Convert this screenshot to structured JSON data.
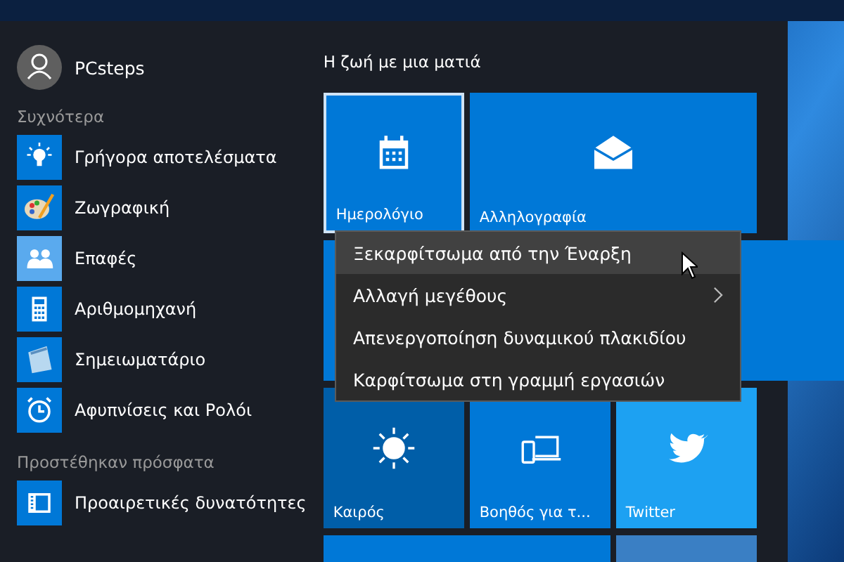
{
  "user": {
    "name": "PCsteps"
  },
  "most_used": {
    "heading": "Συχνότερα",
    "items": [
      {
        "label": "Γρήγορα αποτελέσματα",
        "kind": "bulb"
      },
      {
        "label": "Ζωγραφική",
        "kind": "paint"
      },
      {
        "label": "Επαφές",
        "kind": "people"
      },
      {
        "label": "Αριθμομηχανή",
        "kind": "calc"
      },
      {
        "label": "Σημειωματάριο",
        "kind": "notepad"
      },
      {
        "label": "Αφυπνίσεις και Ρολόι",
        "kind": "clock"
      }
    ]
  },
  "recently_added": {
    "heading": "Προστέθηκαν πρόσφατα",
    "items": [
      {
        "label": "Προαιρετικές δυνατότητες",
        "kind": "features"
      }
    ]
  },
  "tiles": {
    "group_title": "Η ζωή με μια ματιά",
    "items": [
      {
        "label": "Ημερολόγιο",
        "kind": "calendar",
        "selected": true
      },
      {
        "label": "Αλληλογραφία",
        "kind": "mail",
        "selected": false
      },
      {
        "kind": "banner",
        "selected": false
      },
      {
        "label": "Καιρός",
        "kind": "weather",
        "selected": false
      },
      {
        "label": "Βοηθός για τ...",
        "kind": "devices",
        "selected": false
      },
      {
        "label": "Twitter",
        "kind": "twitter",
        "selected": false
      },
      {
        "kind": "blank",
        "selected": false
      },
      {
        "kind": "game",
        "selected": false
      }
    ]
  },
  "context_menu": {
    "items": [
      {
        "label": "Ξεκαρφίτσωμα από την Έναρξη",
        "selected": true,
        "submenu": false
      },
      {
        "label": "Αλλαγή μεγέθους",
        "selected": false,
        "submenu": true
      },
      {
        "label": "Απενεργοποίηση δυναμικού πλακιδίου",
        "selected": false,
        "submenu": false
      },
      {
        "label": "Καρφίτσωμα στη γραμμή εργασιών",
        "selected": false,
        "submenu": false
      }
    ]
  }
}
